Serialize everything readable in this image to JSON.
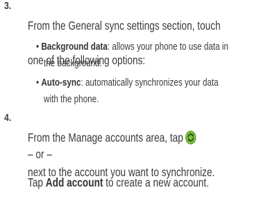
{
  "steps": [
    {
      "number": "3.",
      "line1": "From the General sync settings section, touch",
      "line2": "one of the following options:",
      "bullets": [
        {
          "term": "Background data",
          "rest_line1": ": allows your phone to use data in",
          "line2": "the background."
        },
        {
          "term": "Auto-sync",
          "rest_line1": ": automatically synchronizes your data",
          "line2": "with the phone."
        }
      ]
    },
    {
      "number": "4.",
      "line1": "From the Manage accounts area, tap",
      "line2": "next to the account you want to synchronize.",
      "or_text": "– or –",
      "tap_prefix": "Tap ",
      "tap_term": "Add account",
      "tap_suffix": " to create a new account."
    }
  ],
  "icons": {
    "sync_icon": "sync-icon",
    "sync_green": "#7fc241",
    "sync_dark": "#2e4f17"
  },
  "bullet_char": "•"
}
